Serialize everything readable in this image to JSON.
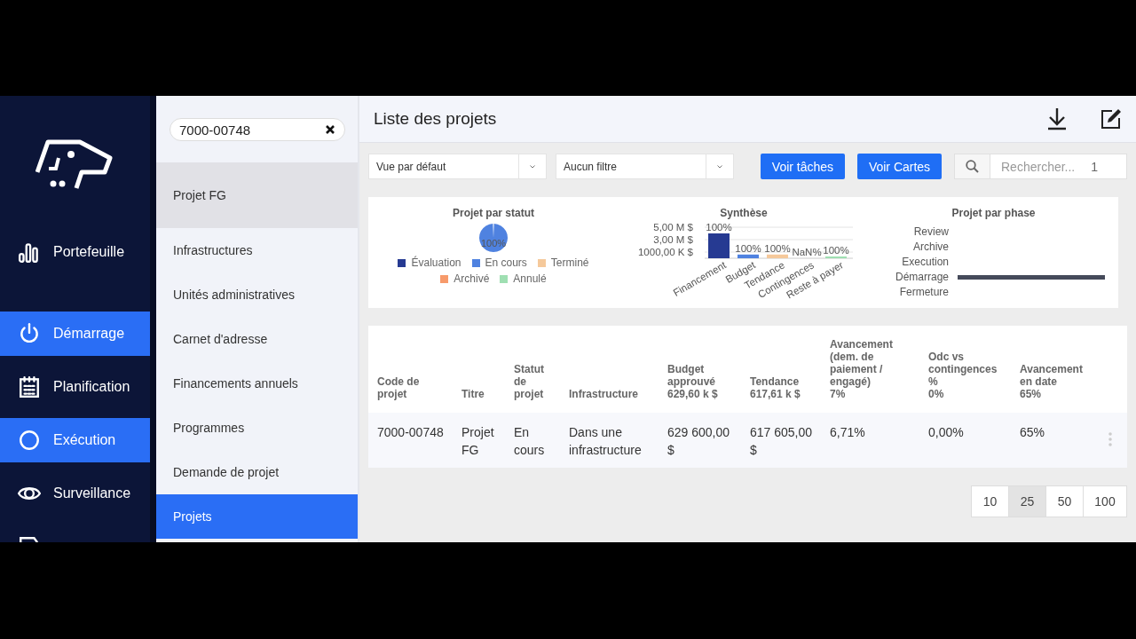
{
  "nav": {
    "items": [
      {
        "label": "Portefeuille",
        "highlighted": false
      },
      {
        "label": "Démarrage",
        "highlighted": true
      },
      {
        "label": "Planification",
        "highlighted": false
      },
      {
        "label": "Exécution",
        "highlighted": true
      },
      {
        "label": "Surveillance",
        "highlighted": false
      },
      {
        "highlighted": false
      }
    ]
  },
  "sub_panel": {
    "search": {
      "value": "7000-00748"
    },
    "current_project": "Projet FG",
    "items": [
      {
        "label": "Infrastructures",
        "selected": false
      },
      {
        "label": "Unités administratives",
        "selected": false
      },
      {
        "label": "Carnet d'adresse",
        "selected": false
      },
      {
        "label": "Financements annuels",
        "selected": false
      },
      {
        "label": "Programmes",
        "selected": false
      },
      {
        "label": "Demande de projet",
        "selected": false
      },
      {
        "label": "Projets",
        "selected": true
      }
    ]
  },
  "header": {
    "title": "Liste des projets"
  },
  "toolbar": {
    "view_select": "Vue par défaut",
    "filter_select": "Aucun filtre",
    "buttons": [
      "Voir tâches",
      "Voir Cartes"
    ],
    "search": {
      "placeholder": "Rechercher...",
      "count": "1"
    }
  },
  "status_chart": {
    "chart_data": {
      "type": "pie",
      "title": "Projet par statut",
      "categories": [
        "Évaluation",
        "En cours",
        "Terminé",
        "Archivé",
        "Annulé"
      ],
      "values": [
        0,
        1,
        0,
        0,
        0
      ],
      "value_labels": [
        null,
        "100%",
        null,
        null,
        null
      ]
    },
    "legend": [
      {
        "color": "#263a92"
      },
      {
        "color": "#4f82e0"
      },
      {
        "color": "#f5c99b"
      },
      {
        "color": "#f79a6b"
      },
      {
        "color": "#9fdfb2"
      }
    ]
  },
  "summary_chart": {
    "chart_data": {
      "type": "bar",
      "title": "Synthèse",
      "categories": [
        "Financement",
        "Budget",
        "Tendance",
        "Contingences",
        "Reste à payer"
      ],
      "values": [
        4000000,
        600000,
        600000,
        0,
        100000
      ],
      "ylim": [
        0,
        5000000
      ],
      "yticks": [
        {
          "value": 1000000,
          "label": "1000,00 K $"
        },
        {
          "value": 3000000,
          "label": "3,00 M $"
        },
        {
          "value": 5000000,
          "label": "5,00 M $"
        }
      ]
    },
    "bars": [
      {
        "label": "100%",
        "color": "#263a92"
      },
      {
        "label": "100%",
        "color": "#4f82e0"
      },
      {
        "label": "100%",
        "color": "#f5c99b"
      },
      {
        "label": "NaN%"
      },
      {
        "label": "100%",
        "color": "#9fdfb2"
      }
    ]
  },
  "phase_chart": {
    "title": "Projet par phase",
    "rows": [
      {
        "label": "Review",
        "bar": false
      },
      {
        "label": "Archive",
        "bar": false
      },
      {
        "label": "Execution",
        "bar": false
      },
      {
        "label": "Démarrage",
        "bar": true
      },
      {
        "label": "Fermeture",
        "bar": false
      }
    ]
  },
  "table": {
    "columns": [
      {
        "title": "Code de projet"
      },
      {
        "title": "Titre"
      },
      {
        "title": "Statut de projet"
      },
      {
        "title": "Infrastructure"
      },
      {
        "title": "Budget approuvé",
        "summary": "629,60 k $"
      },
      {
        "title": "Tendance",
        "summary": "617,61 k $"
      },
      {
        "title": "Avancement (dem. de paiement / engagé)",
        "summary": "7%"
      },
      {
        "title": "Odc vs contingences %",
        "summary": "0%"
      },
      {
        "title": "Avancement en date",
        "summary": "65%"
      }
    ],
    "rows": [
      [
        "7000-00748",
        "Projet FG",
        "En cours",
        "Dans une infrastructure",
        "629 600,00 $",
        "617 605,00 $",
        "6,71%",
        "0,00%",
        "65%"
      ]
    ]
  },
  "pagination": [
    {
      "label": "10",
      "selected": false
    },
    {
      "label": "25",
      "selected": true
    },
    {
      "label": "50",
      "selected": false
    },
    {
      "label": "100",
      "selected": false
    }
  ]
}
